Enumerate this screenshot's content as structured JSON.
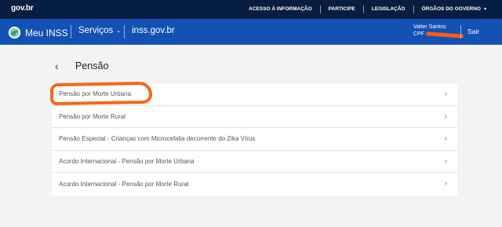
{
  "govbar": {
    "logo": "gov.br",
    "links": [
      {
        "label": "ACESSO À INFORMAÇÃO",
        "caret": false
      },
      {
        "label": "PARTICIPE",
        "caret": false
      },
      {
        "label": "LEGISLAÇÃO",
        "caret": false
      },
      {
        "label": "ÓRGÃOS DO GOVERNO",
        "caret": true
      }
    ],
    "caret_glyph": "▾"
  },
  "header": {
    "app_name": "Meu INSS",
    "services_label": "Serviços",
    "services_chevron": "⌄",
    "domain": "inss.gov.br",
    "user_name": "Valter Santos",
    "cpf_label": "CPF",
    "logout": "Sair"
  },
  "page": {
    "back_glyph": "‹",
    "title": "Pensão"
  },
  "items": [
    {
      "label": "Pensão por Morte Urbana"
    },
    {
      "label": "Pensão por Morte Rural"
    },
    {
      "label": "Pensão Especial - Crianças com Microcefalia decorrente do Zika Vírus"
    },
    {
      "label": "Acordo Internacional - Pensão por Morte Urbana"
    },
    {
      "label": "Acordo Internacional - Pensão por Morte Rural"
    }
  ],
  "item_chevron": "›",
  "colors": {
    "govbar": "#071d41",
    "header": "#1351b4",
    "highlight": "#f86618"
  }
}
